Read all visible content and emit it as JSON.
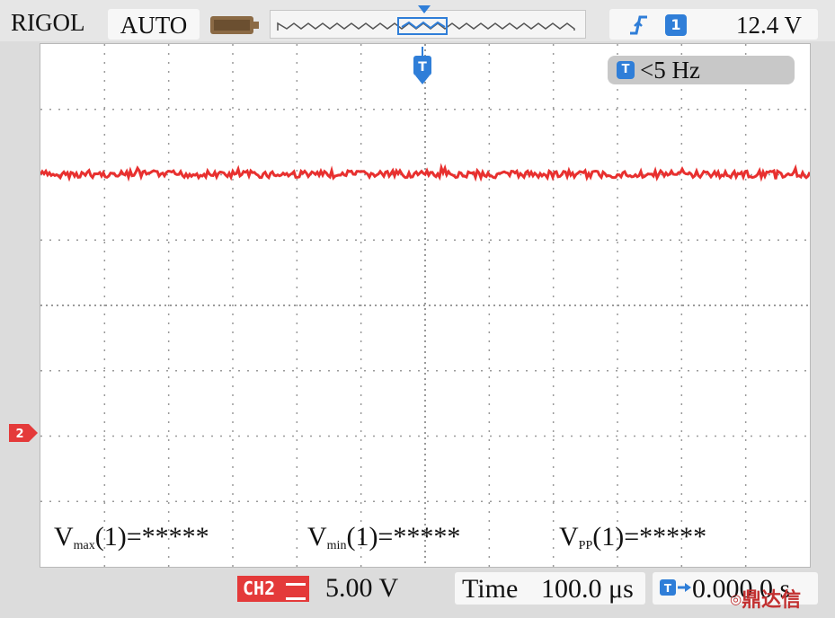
{
  "header": {
    "brand": "RIGOL",
    "mode": "AUTO",
    "trigger_source": "1",
    "trigger_level": "12.4 V"
  },
  "screen": {
    "frequency": "<5 Hz",
    "ch2_marker_label": "2",
    "trigger_marker_label": "T",
    "measurements": [
      {
        "prefix": "V",
        "sub": "max",
        "suffix": "(1)=*****"
      },
      {
        "prefix": "V",
        "sub": "min",
        "suffix": "(1)=*****"
      },
      {
        "prefix": "V",
        "sub": "PP",
        "suffix": "(1)=*****"
      }
    ]
  },
  "footer": {
    "channel_label": "CH2",
    "channel_scale": "5.00 V",
    "time_label": "Time",
    "time_scale": "100.0 μs",
    "time_offset": "0.000 0 s"
  },
  "watermark": "鼎达信",
  "colors": {
    "trace": "#e8302f",
    "channel_badge": "#e43a3a",
    "trigger_blue": "#2f7ed8",
    "screen_bg": "#ffffff",
    "frame_bg": "#dcdcdc"
  },
  "icons": {
    "memory": "battery-bar-icon",
    "trigger_edge": "rising-edge-icon",
    "trigger_marker": "trigger-position-marker-icon",
    "offset": "horizontal-offset-arrow-icon"
  }
}
